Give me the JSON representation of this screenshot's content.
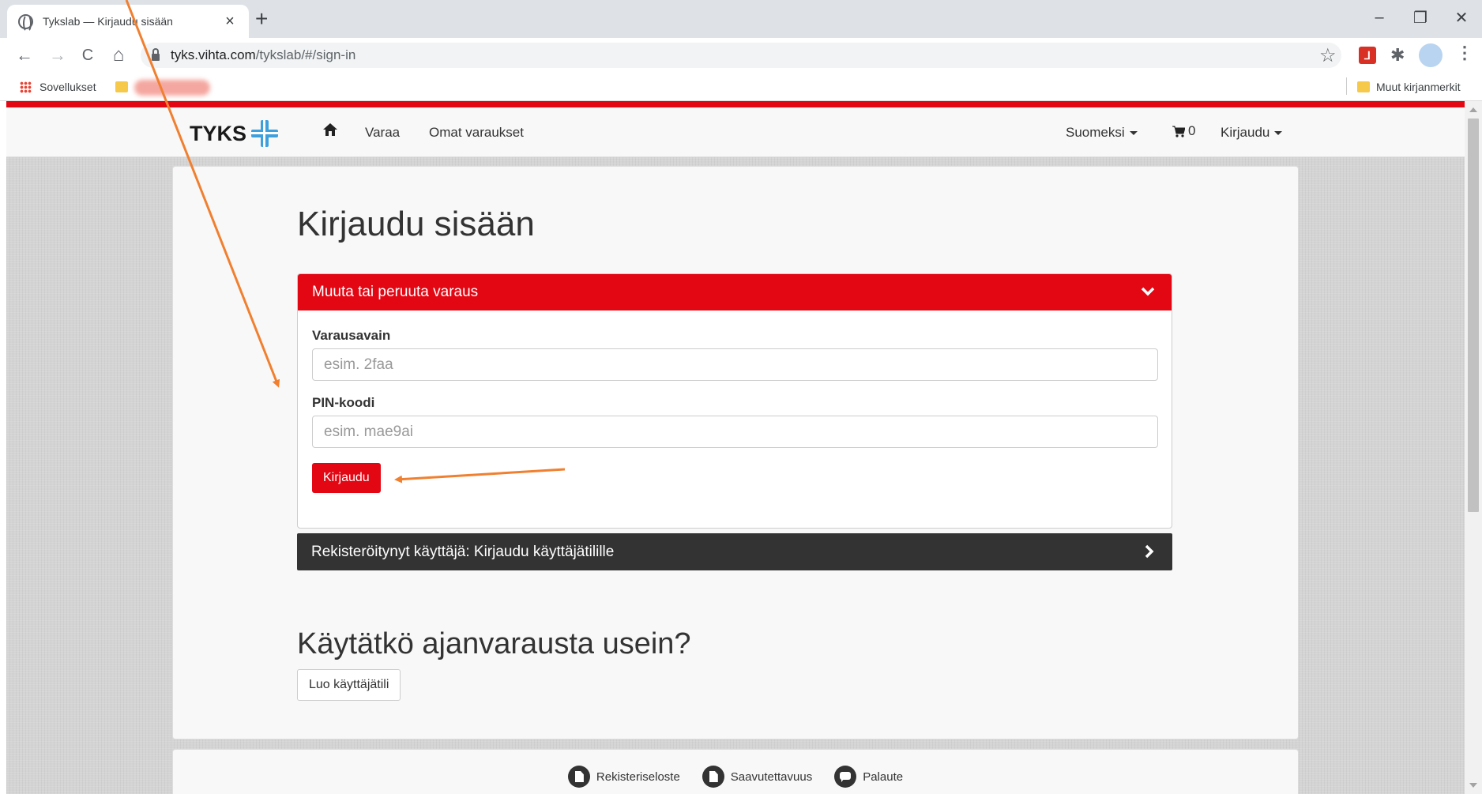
{
  "browser": {
    "tab_title": "Tykslab — Kirjaudu sisään",
    "tab_close": "×",
    "new_tab": "+",
    "url_host": "tyks.vihta.com",
    "url_path": "/tykslab/#/sign-in",
    "window_controls": {
      "minimize": "–",
      "restore": "❐",
      "close": "✕"
    },
    "nav": {
      "back": "←",
      "forward": "→",
      "reload": "C",
      "home": "⌂"
    },
    "star": "☆",
    "puzzle": "✱",
    "menu": "⋮",
    "pdf_ext": "⅃"
  },
  "bookmarks": {
    "apps_label": "Sovellukset",
    "other_label": "Muut kirjanmerkit"
  },
  "navbar": {
    "logo_text": "TYKS",
    "links": {
      "book": "Varaa",
      "my_bookings": "Omat varaukset"
    },
    "language": "Suomeksi",
    "cart_count": "0",
    "login": "Kirjaudu"
  },
  "main": {
    "title": "Kirjaudu sisään",
    "change_panel": {
      "header": "Muuta tai peruuta varaus",
      "booking_key_label": "Varausavain",
      "booking_key_placeholder": "esim. 2faa",
      "pin_label": "PIN-koodi",
      "pin_placeholder": "esim. mae9ai",
      "submit_label": "Kirjaudu"
    },
    "registered_panel": {
      "header": "Rekisteröitynyt käyttäjä: Kirjaudu käyttäjätilille"
    },
    "frequent_title": "Käytätkö ajanvarausta usein?",
    "create_account_label": "Luo käyttäjätili"
  },
  "footer": {
    "links": [
      "Rekisteriseloste",
      "Saavutettavuus",
      "Palaute"
    ]
  },
  "colors": {
    "brand_red": "#e30613",
    "dark_panel": "#333333",
    "annotation_orange": "#f08030",
    "logo_blue": "#3da0dc"
  },
  "icons": [
    "globe-icon",
    "lock-icon",
    "home-icon",
    "cart-icon",
    "chevron-down-icon",
    "chevron-right-icon",
    "document-icon",
    "chat-icon"
  ]
}
